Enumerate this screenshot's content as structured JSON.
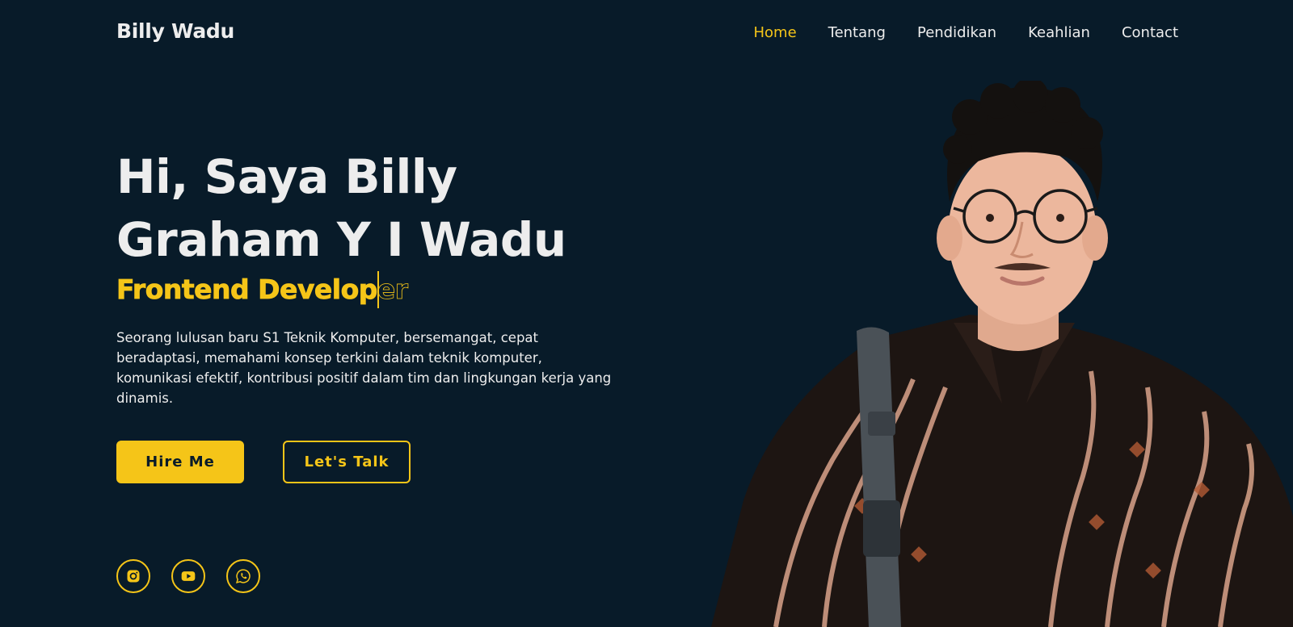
{
  "header": {
    "logo": "Billy Wadu",
    "nav": [
      "Home",
      "Tentang",
      "Pendidikan",
      "Keahlian",
      "Contact"
    ]
  },
  "hero": {
    "title_line1": "Hi, Saya Billy",
    "title_line2": "Graham Y I Wadu",
    "role": "Frontend Developer",
    "description": "Seorang lulusan baru S1 Teknik Komputer, bersemangat, cepat beradaptasi, memahami konsep terkini dalam teknik komputer, komunikasi efektif, kontribusi positif dalam tim dan lingkungan kerja yang dinamis."
  },
  "buttons": {
    "hire": "Hire Me",
    "talk": "Let's Talk"
  },
  "socials": [
    "instagram-icon",
    "youtube-icon",
    "whatsapp-icon"
  ],
  "colors": {
    "background": "#081b29",
    "accent": "#f5c518",
    "text": "#ededed"
  }
}
